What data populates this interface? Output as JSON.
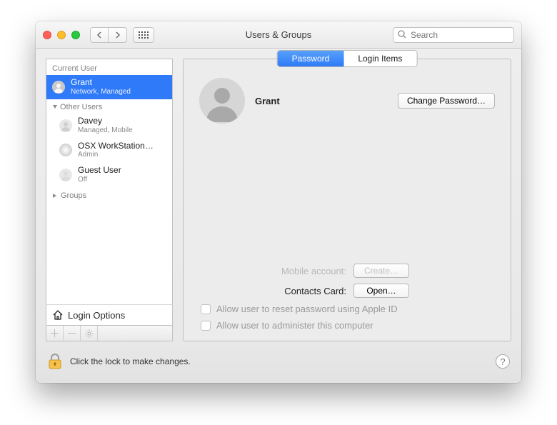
{
  "window": {
    "title": "Users & Groups",
    "search_placeholder": "Search"
  },
  "sidebar": {
    "current_user_label": "Current User",
    "other_users_label": "Other Users",
    "groups_label": "Groups",
    "login_options_label": "Login Options",
    "current_user": {
      "name": "Grant",
      "subtitle": "Network, Managed"
    },
    "other_users": [
      {
        "name": "Davey",
        "subtitle": "Managed, Mobile"
      },
      {
        "name": "OSX WorkStation…",
        "subtitle": "Admin"
      },
      {
        "name": "Guest User",
        "subtitle": "Off"
      }
    ]
  },
  "tabs": {
    "password": "Password",
    "login_items": "Login Items"
  },
  "panel": {
    "user_name": "Grant",
    "change_password": "Change Password…",
    "mobile_account_label": "Mobile account:",
    "create_btn": "Create…",
    "contacts_card_label": "Contacts Card:",
    "open_btn": "Open…",
    "allow_reset": "Allow user to reset password using Apple ID",
    "allow_admin": "Allow user to administer this computer"
  },
  "footer": {
    "lock_text": "Click the lock to make changes."
  }
}
